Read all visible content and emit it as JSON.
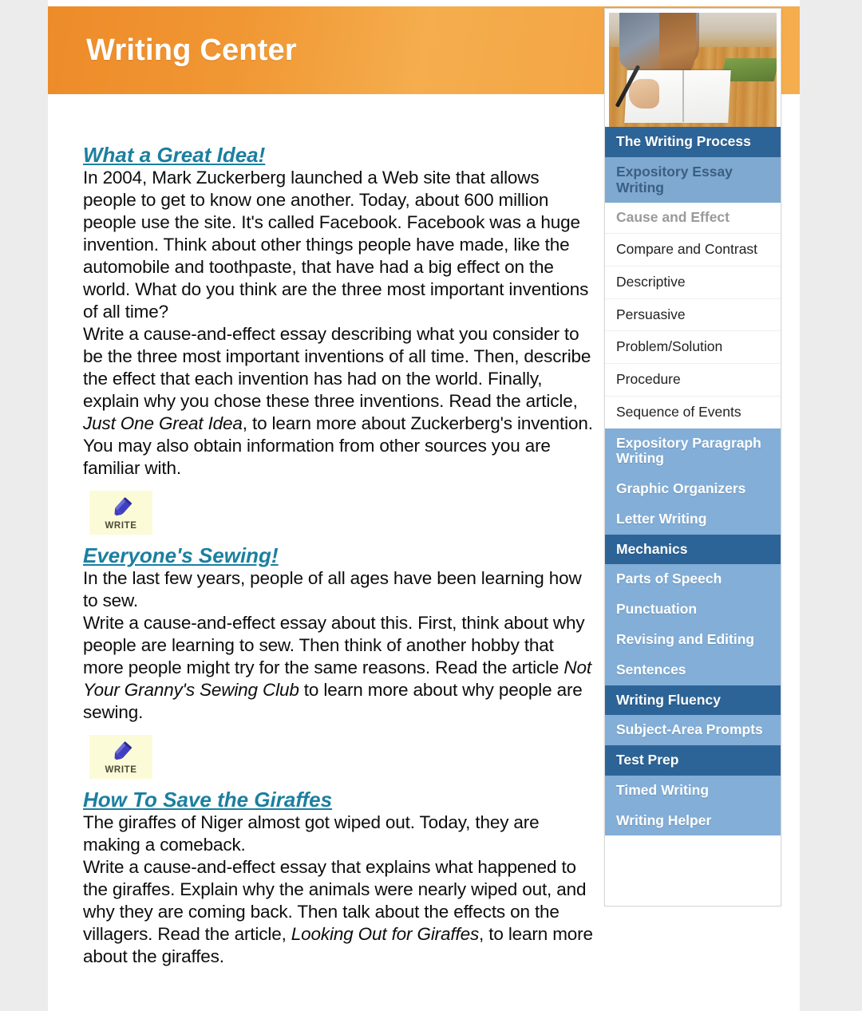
{
  "header": {
    "title": "Writing Center"
  },
  "sidebar": {
    "photo": {
      "alt_name": "girl-writing-in-notebook-photo"
    },
    "items": [
      {
        "label": "The Writing Process",
        "style": "section-dark",
        "name": "nav-the-writing-process"
      },
      {
        "label": "Expository Essay Writing",
        "style": "section-active",
        "name": "nav-expository-essay-writing"
      },
      {
        "label": "Cause and Effect",
        "style": "sub-current",
        "name": "nav-cause-and-effect"
      },
      {
        "label": "Compare and Contrast",
        "style": "sub",
        "name": "nav-compare-and-contrast"
      },
      {
        "label": "Descriptive",
        "style": "sub",
        "name": "nav-descriptive"
      },
      {
        "label": "Persuasive",
        "style": "sub",
        "name": "nav-persuasive"
      },
      {
        "label": "Problem/Solution",
        "style": "sub",
        "name": "nav-problem-solution"
      },
      {
        "label": "Procedure",
        "style": "sub",
        "name": "nav-procedure"
      },
      {
        "label": "Sequence of Events",
        "style": "sub",
        "name": "nav-sequence-of-events"
      },
      {
        "label": "Expository Paragraph Writing",
        "style": "section-light",
        "name": "nav-expository-paragraph-writing"
      },
      {
        "label": "Graphic Organizers",
        "style": "section-light",
        "name": "nav-graphic-organizers"
      },
      {
        "label": "Letter Writing",
        "style": "section-light",
        "name": "nav-letter-writing"
      },
      {
        "label": "Mechanics",
        "style": "section-dark",
        "name": "nav-mechanics"
      },
      {
        "label": "Parts of Speech",
        "style": "section-light",
        "name": "nav-parts-of-speech"
      },
      {
        "label": "Punctuation",
        "style": "section-light",
        "name": "nav-punctuation"
      },
      {
        "label": "Revising and Editing",
        "style": "section-light",
        "name": "nav-revising-and-editing"
      },
      {
        "label": "Sentences",
        "style": "section-light",
        "name": "nav-sentences"
      },
      {
        "label": "Writing Fluency",
        "style": "section-dark",
        "name": "nav-writing-fluency"
      },
      {
        "label": "Subject-Area Prompts",
        "style": "section-light",
        "name": "nav-subject-area-prompts"
      },
      {
        "label": "Test Prep",
        "style": "section-dark",
        "name": "nav-test-prep"
      },
      {
        "label": "Timed Writing",
        "style": "section-light",
        "name": "nav-timed-writing"
      },
      {
        "label": "Writing Helper",
        "style": "section-light",
        "name": "nav-writing-helper"
      }
    ]
  },
  "main": {
    "write_button_label": "WRITE",
    "articles": [
      {
        "title": "What a Great Idea!",
        "paragraphs": [
          {
            "parts": [
              {
                "text": "In 2004, Mark Zuckerberg launched a Web site that allows people to get to know one another. Today, about 600 million people use the site. It's called Facebook. Facebook was a huge invention. Think about other things people have made, like the automobile and toothpaste, that have had a big effect on the world. What do you think are the three most important inventions of all time?",
                "italic": false
              }
            ]
          },
          {
            "parts": [
              {
                "text": "Write a cause-and-effect essay describing what you consider to be the three most important inventions of all time. Then, describe the effect that each invention has had on the world. Finally, explain why you chose these three inventions. Read the article, ",
                "italic": false
              },
              {
                "text": "Just One Great Idea",
                "italic": true
              },
              {
                "text": ", to learn more about Zuckerberg's invention. You may also obtain information from other sources you are familiar with.",
                "italic": false
              }
            ]
          }
        ],
        "has_write_button": true
      },
      {
        "title": "Everyone's Sewing!",
        "paragraphs": [
          {
            "parts": [
              {
                "text": "In the last few years, people of all ages have been learning how to sew.",
                "italic": false
              }
            ]
          },
          {
            "parts": [
              {
                "text": "Write a cause-and-effect essay about this. First, think about why people are learning to sew. Then think of another hobby that more people might try for the same reasons. Read the article ",
                "italic": false
              },
              {
                "text": "Not Your Granny's Sewing Club",
                "italic": true
              },
              {
                "text": " to learn more about why people are sewing.",
                "italic": false
              }
            ]
          }
        ],
        "has_write_button": true
      },
      {
        "title": "How To Save the Giraffes",
        "paragraphs": [
          {
            "parts": [
              {
                "text": "The giraffes of Niger almost got wiped out. Today, they are making a comeback.",
                "italic": false
              }
            ]
          },
          {
            "parts": [
              {
                "text": "Write a cause-and-effect essay that explains what happened to the giraffes. Explain why the animals were nearly wiped out, and why they are coming back. Then talk about the effects on the villagers. Read the article, ",
                "italic": false
              },
              {
                "text": "Looking Out for Giraffes",
                "italic": true
              },
              {
                "text": ", to learn more about the giraffes.",
                "italic": false
              }
            ]
          }
        ],
        "has_write_button": false
      }
    ]
  },
  "colors": {
    "header_orange": "#f09733",
    "nav_dark_blue": "#2d6498",
    "nav_light_blue": "#82aed7",
    "link_teal": "#1b7fa0",
    "write_bg_yellow": "#fbfbd8",
    "pencil_blue": "#3f3fbf"
  }
}
